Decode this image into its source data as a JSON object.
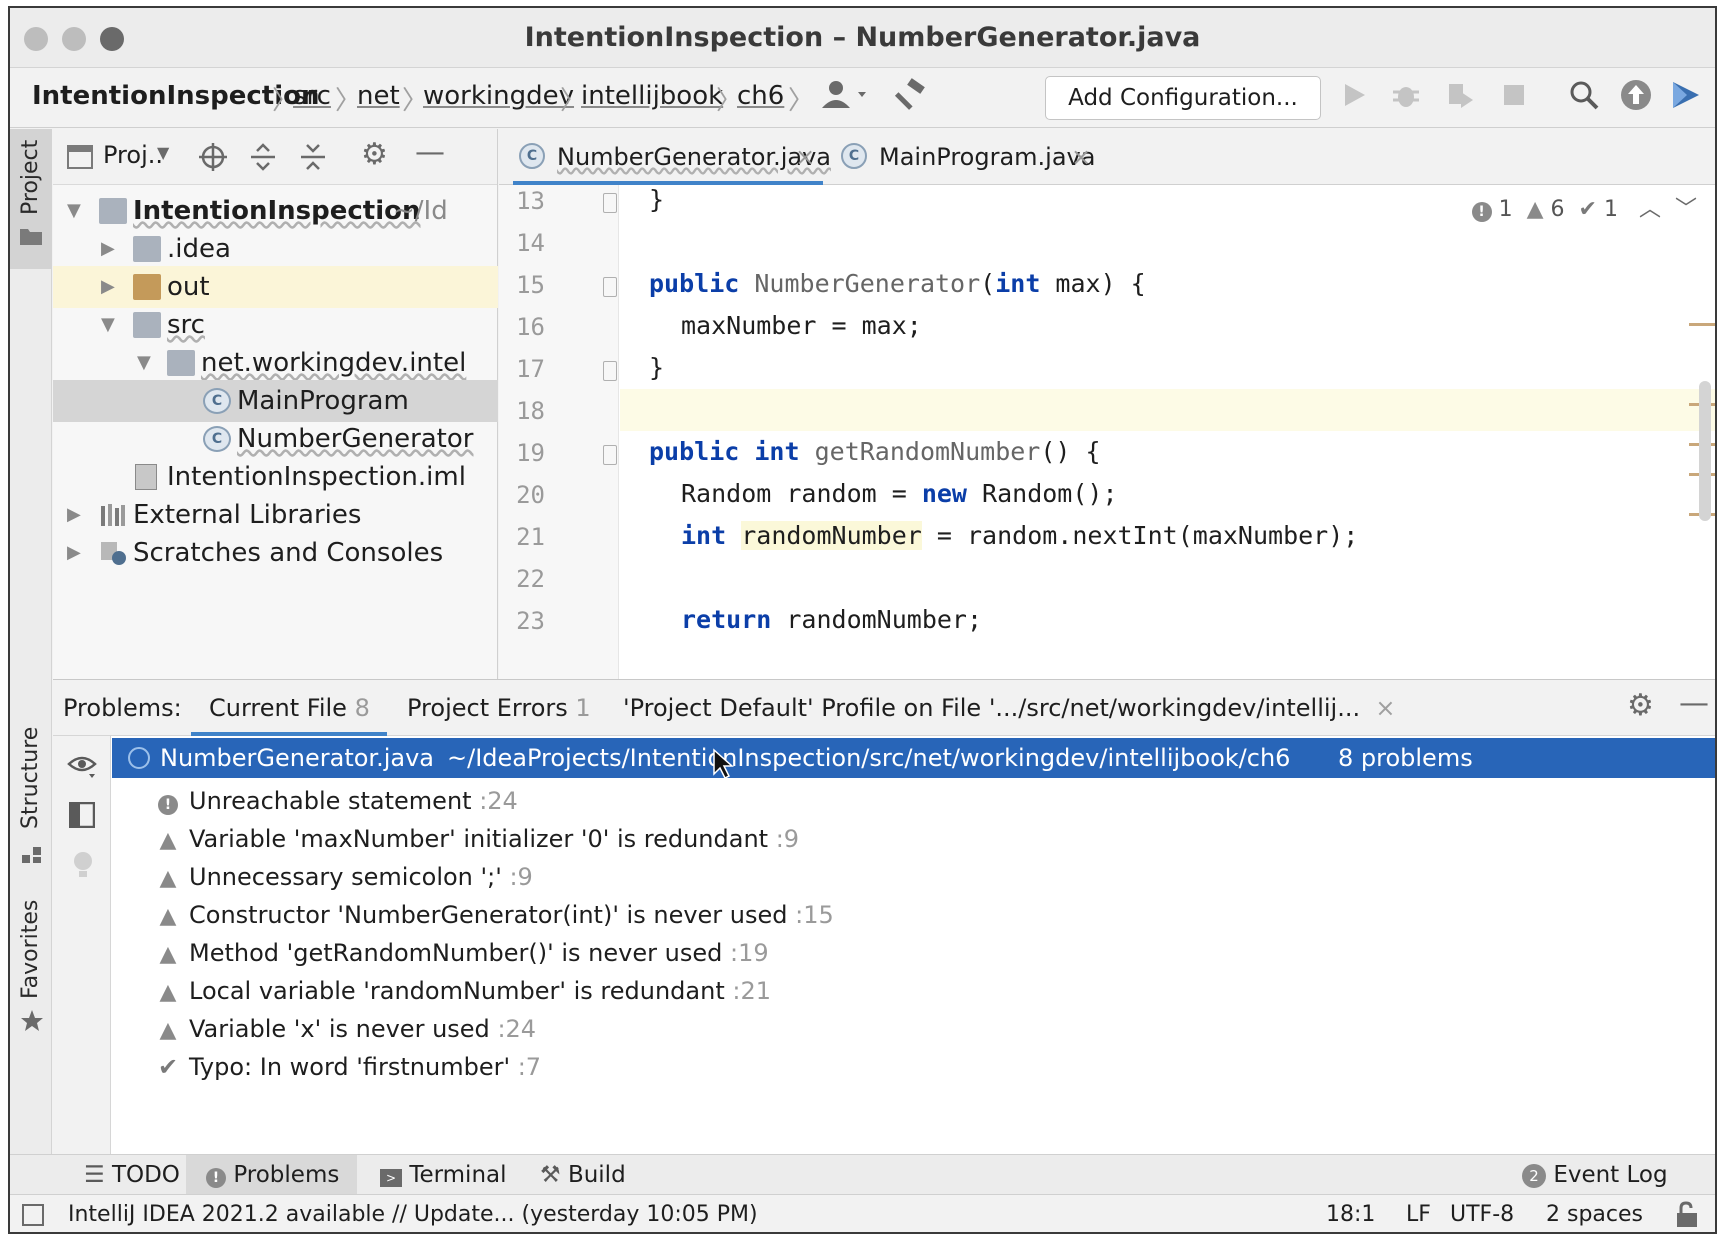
{
  "window": {
    "title": "IntentionInspection – NumberGenerator.java"
  },
  "navbar": {
    "breadcrumbs": [
      "IntentionInspection",
      "src",
      "net",
      "workingdev",
      "intellijbook",
      "ch6"
    ],
    "add_configuration": "Add Configuration..."
  },
  "left_strip": {
    "project_tab": "Project",
    "structure_tab": "Structure",
    "favorites_tab": "Favorites"
  },
  "project_panel": {
    "view_selector": "Proj..",
    "tree": [
      {
        "label": "IntentionInspection",
        "suffix": "~/Id"
      },
      {
        "label": ".idea"
      },
      {
        "label": "out"
      },
      {
        "label": "src"
      },
      {
        "label": "net.workingdev.intel"
      },
      {
        "label": "MainProgram"
      },
      {
        "label": "NumberGenerator"
      },
      {
        "label": "IntentionInspection.iml"
      },
      {
        "label": "External Libraries"
      },
      {
        "label": "Scratches and Consoles"
      }
    ]
  },
  "editor": {
    "tabs": [
      {
        "label": "NumberGenerator.java",
        "close": "×"
      },
      {
        "label": "MainProgram.java",
        "close": "×"
      }
    ],
    "inspection_counts": {
      "errors": "1",
      "warnings": "6",
      "typos": "1"
    },
    "line_numbers": [
      "13",
      "14",
      "15",
      "16",
      "17",
      "18",
      "19",
      "20",
      "21",
      "22",
      "23"
    ],
    "code": {
      "l13": "}",
      "l15_kw": "public",
      "l15_fn": "NumberGenerator",
      "l15_p1": "(",
      "l15_kw2": "int",
      "l15_rest": " max) {",
      "l16": "maxNumber = max;",
      "l17": "}",
      "l19_kw": "public",
      "l19_kw2": "int",
      "l19_fn": "getRandomNumber",
      "l19_rest": "() {",
      "l20_a": "Random random = ",
      "l20_kw": "new",
      "l20_b": " Random();",
      "l21_kw": "int",
      "l21_var": "randomNumber",
      "l21_rest": " = random.nextInt(maxNumber);",
      "l23_kw": "return",
      "l23_rest": " randomNumber;"
    }
  },
  "problems": {
    "label": "Problems:",
    "tabs": [
      {
        "label": "Current File",
        "count": "8"
      },
      {
        "label": "Project Errors",
        "count": "1"
      },
      {
        "label": "'Project Default' Profile on File '.../src/net/workingdev/intellij...",
        "close": "×"
      }
    ],
    "file_row": {
      "file": "NumberGenerator.java",
      "path": "~/IdeaProjects/IntentionInspection/src/net/workingdev/intellijbook/ch6",
      "count": "8 problems"
    },
    "items": [
      {
        "type": "error",
        "text": "Unreachable statement",
        "line": ":24"
      },
      {
        "type": "warning",
        "text": "Variable 'maxNumber' initializer '0' is redundant",
        "line": ":9"
      },
      {
        "type": "warning",
        "text": "Unnecessary semicolon ';'",
        "line": ":9"
      },
      {
        "type": "warning",
        "text": "Constructor 'NumberGenerator(int)' is never used",
        "line": ":15"
      },
      {
        "type": "warning",
        "text": "Method 'getRandomNumber()' is never used",
        "line": ":19"
      },
      {
        "type": "warning",
        "text": "Local variable 'randomNumber' is redundant",
        "line": ":21"
      },
      {
        "type": "warning",
        "text": "Variable 'x' is never used",
        "line": ":24"
      },
      {
        "type": "typo",
        "text": "Typo: In word 'firstnumber'",
        "line": ":7"
      }
    ]
  },
  "tool_windows": {
    "todo": "TODO",
    "problems": "Problems",
    "terminal": "Terminal",
    "build": "Build",
    "event_log_count": "2",
    "event_log": "Event Log"
  },
  "status_bar": {
    "message": "IntelliJ IDEA 2021.2 available // Update... (yesterday 10:05 PM)",
    "position": "18:1",
    "line_sep": "LF",
    "encoding": "UTF-8",
    "indent": "2 spaces"
  }
}
